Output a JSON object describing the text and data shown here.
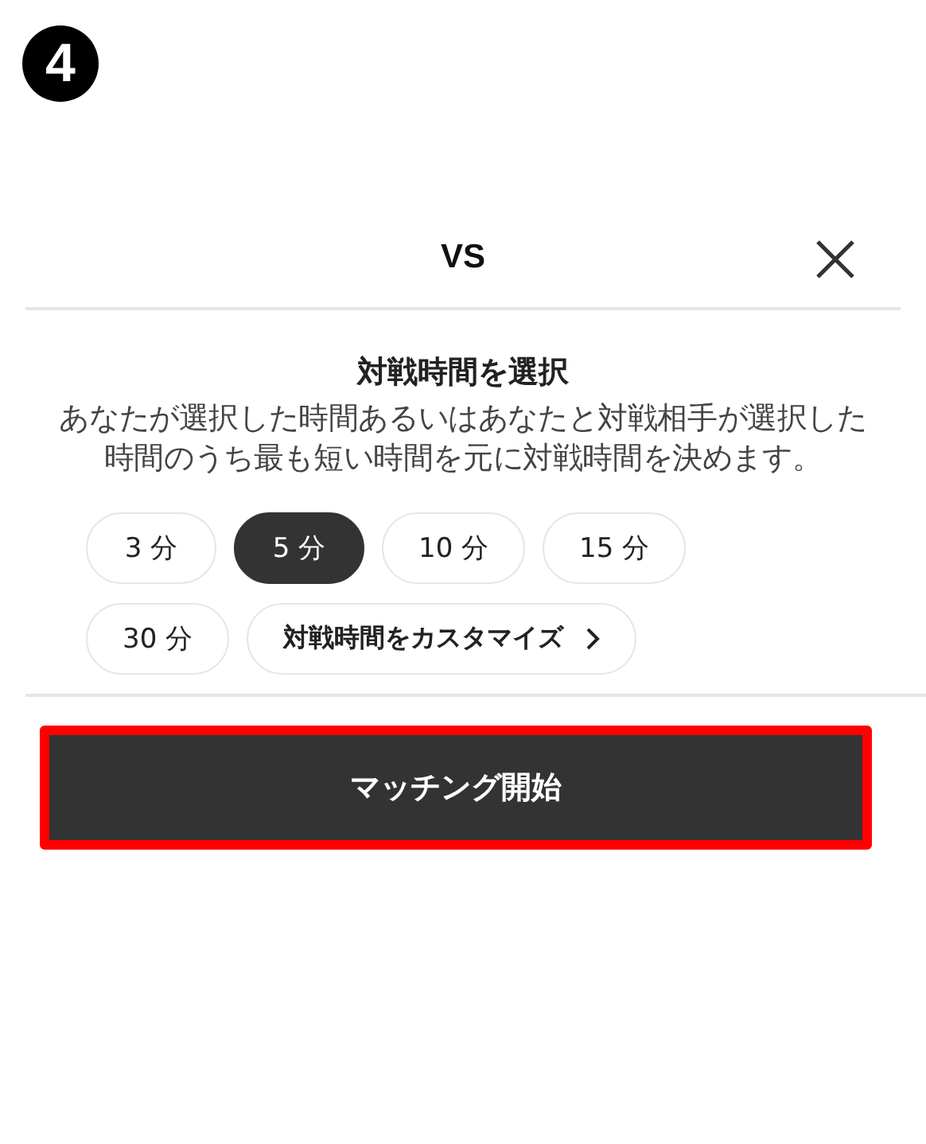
{
  "step_badge": "4",
  "header": {
    "title": "VS",
    "close_icon": true
  },
  "time_selection": {
    "heading": "対戦時間を選択",
    "description": "あなたが選択した時間あるいはあなたと対戦相手が選択した時間のうち最も短い時間を元に対戦時間を決めます。",
    "options": [
      {
        "kind": "time",
        "label": "3 分",
        "selected": false
      },
      {
        "kind": "time",
        "label": "5 分",
        "selected": true
      },
      {
        "kind": "time",
        "label": "10 分",
        "selected": false
      },
      {
        "kind": "time",
        "label": "15 分",
        "selected": false
      },
      {
        "kind": "time",
        "label": "30 分",
        "selected": false
      },
      {
        "kind": "custom",
        "label": "対戦時間をカスタマイズ",
        "selected": false
      }
    ]
  },
  "start_button": {
    "label": "マッチング開始",
    "highlighted": true
  }
}
